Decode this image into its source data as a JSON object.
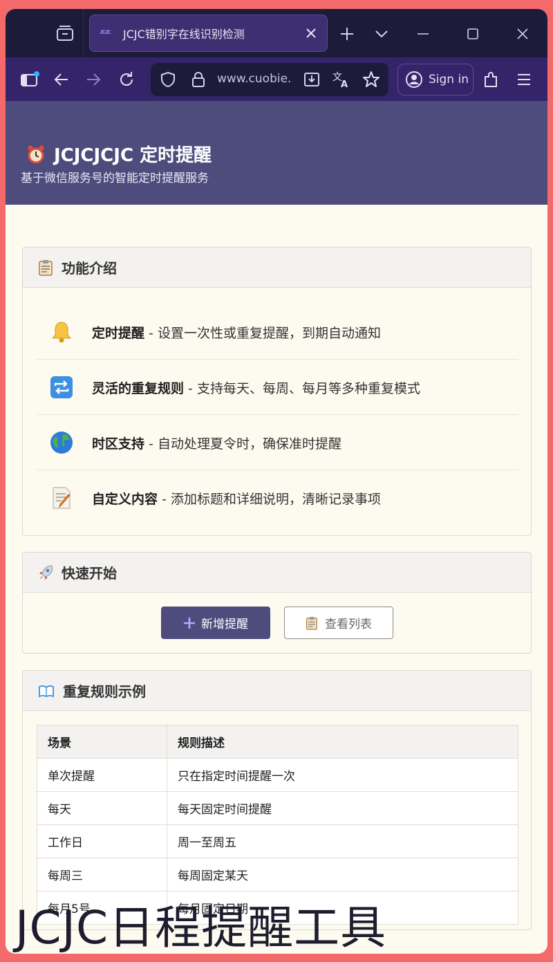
{
  "browser": {
    "tab_title": "JCJC错别字在线识别检测",
    "favicon_text": "JCJC",
    "url": "www.cuobie.",
    "sign_in": "Sign in"
  },
  "hero": {
    "title": "JCJCJCJC 定时提醒",
    "subtitle": "基于微信服务号的智能定时提醒服务"
  },
  "features": {
    "heading": "功能介绍",
    "items": [
      {
        "icon": "bell-icon",
        "title": "定时提醒",
        "desc": " - 设置一次性或重复提醒，到期自动通知"
      },
      {
        "icon": "repeat-icon",
        "title": "灵活的重复规则",
        "desc": " - 支持每天、每周、每月等多种重复模式"
      },
      {
        "icon": "globe-icon",
        "title": "时区支持",
        "desc": " - 自动处理夏令时，确保准时提醒"
      },
      {
        "icon": "memo-icon",
        "title": "自定义内容",
        "desc": " - 添加标题和详细说明，清晰记录事项"
      }
    ]
  },
  "quickstart": {
    "heading": "快速开始",
    "add_label": "新增提醒",
    "list_label": "查看列表"
  },
  "rules": {
    "heading": "重复规则示例",
    "columns": [
      "场景",
      "规则描述"
    ],
    "rows": [
      [
        "单次提醒",
        "只在指定时间提醒一次"
      ],
      [
        "每天",
        "每天固定时间提醒"
      ],
      [
        "工作日",
        "周一至周五"
      ],
      [
        "每周三",
        "每周固定某天"
      ],
      [
        "每月5号",
        "每月固定日期"
      ]
    ]
  },
  "watermark": "JCJC日程提醒工具",
  "colors": {
    "frame": "#f46a6a",
    "tabstrip": "#1c1b3a",
    "navbar": "#35246a",
    "hero": "#4e4c7d",
    "page_bg": "#fdfbf0",
    "primary_button": "#4e4c7d"
  }
}
